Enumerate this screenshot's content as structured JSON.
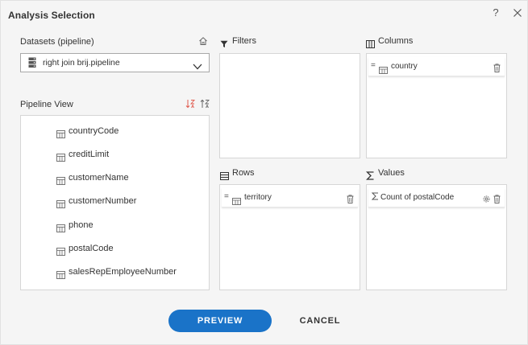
{
  "dialog": {
    "title": "Analysis Selection",
    "help_label": "?"
  },
  "datasets": {
    "label": "Datasets (pipeline)",
    "selected": "right join brij.pipeline"
  },
  "pipeline_view": {
    "label": "Pipeline View",
    "items": [
      {
        "label": "countryCode"
      },
      {
        "label": "creditLimit"
      },
      {
        "label": "customerName"
      },
      {
        "label": "customerNumber"
      },
      {
        "label": "phone"
      },
      {
        "label": "postalCode"
      },
      {
        "label": "salesRepEmployeeNumber"
      }
    ]
  },
  "filters": {
    "label": "Filters",
    "items": []
  },
  "columns": {
    "label": "Columns",
    "items": [
      {
        "label": "country"
      }
    ]
  },
  "rows": {
    "label": "Rows",
    "items": [
      {
        "label": "territory"
      }
    ]
  },
  "values": {
    "label": "Values",
    "items": [
      {
        "label": "Count of postalCode"
      }
    ]
  },
  "actions": {
    "preview_label": "PREVIEW",
    "cancel_label": "CANCEL"
  },
  "colors": {
    "accent": "#1a73c8",
    "sort_accent": "#e05a4e"
  }
}
